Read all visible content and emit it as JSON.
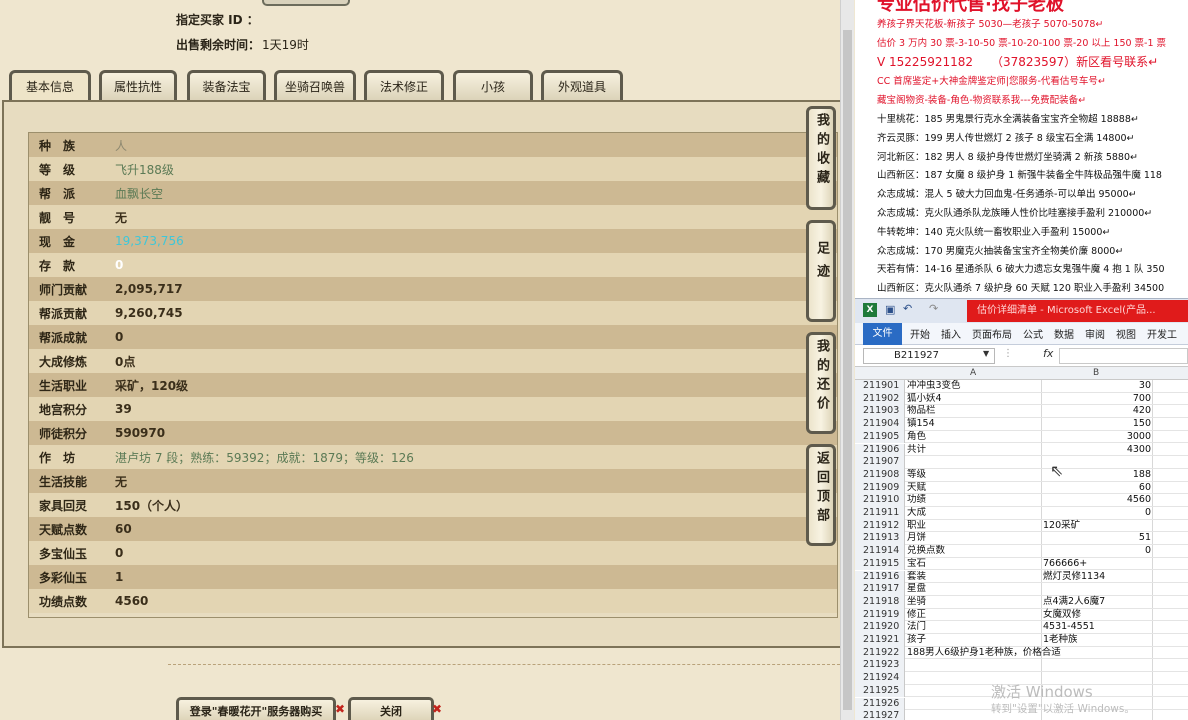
{
  "header": {
    "buyer_label": "指定买家 ID ：",
    "time_label": "出售剩余时间：",
    "time_value": "1天19时"
  },
  "tabs": [
    "基本信息",
    "属性抗性",
    "装备法宝",
    "坐骑召唤兽",
    "法术修正",
    "小孩",
    "外观道具"
  ],
  "info_rows": [
    {
      "k": "种　族",
      "v": "人"
    },
    {
      "k": "等　级",
      "v": "飞升188级"
    },
    {
      "k": "帮　派",
      "v": "血飘长空"
    },
    {
      "k": "靓　号",
      "v": "无"
    },
    {
      "k": "现　金",
      "v": "19,373,756"
    },
    {
      "k": "存　款",
      "v": "0"
    },
    {
      "k": "师门贡献",
      "v": "2,095,717"
    },
    {
      "k": "帮派贡献",
      "v": "9,260,745"
    },
    {
      "k": "帮派成就",
      "v": "0"
    },
    {
      "k": "大成修炼",
      "v": "0点"
    },
    {
      "k": "生活职业",
      "v": "采矿，120级"
    },
    {
      "k": "地宫积分",
      "v": "39"
    },
    {
      "k": "师徒积分",
      "v": "590970"
    },
    {
      "k": "作　坊",
      "v": "湛卢坊 7 段；熟练：59392；成就：1879；等级：126"
    },
    {
      "k": "生活技能",
      "v": "无"
    },
    {
      "k": "家具回灵",
      "v": "150（个人）"
    },
    {
      "k": "天赋点数",
      "v": "60"
    },
    {
      "k": "多宝仙玉",
      "v": "0"
    },
    {
      "k": "多彩仙玉",
      "v": "1"
    },
    {
      "k": "功绩点数",
      "v": "4560"
    }
  ],
  "side_buttons": [
    "我的收藏",
    "足迹",
    "我的还价",
    "返回顶部"
  ],
  "bottom_buttons": {
    "login": "登录\"春暖花开\"服务器购买",
    "close": "关闭"
  },
  "doc": {
    "banner": "专业估价代售·找子老板",
    "lines": [
      "养孩子界天花板-新孩子 5030—老孩子 5070-5078↵",
      "估价 3 万内 30 票-3-10-50 票-10-20-100 票-20 以上 150 票-1 票",
      "V 15225921182　　（37823597）新区看号联系↵",
      "CC 首席鉴定+大神金牌鉴定师|您服务-代看估号车号↵",
      "藏宝阁物资-装备-角色-物资联系我---免费配装备↵",
      "十里桃花：185 男鬼景行克水全满装备宝宝齐全物超 18888↵",
      "齐云灵豚：199 男人传世燃灯 2 孩子 8 级宝石全满 14800↵",
      "河北新区：182 男人 8 级护身传世燃灯坐骑满 2 新孩 5880↵",
      "山西新区：187 女魔 8 级护身 1 新强牛装备全牛阵极品强牛魔 118",
      "众志成城：混人 5 破大力回血鬼-任务通杀-可以单出 95000↵",
      "众志成城：克火队通杀队龙族睡人性价比哇塞接手盈利 210000↵",
      "牛转乾坤：140 克火队统一畜牧职业入手盈利 15000↵",
      "众志成城：170 男魔克火抽装备宝宝齐全物美价廉 8000↵",
      "天若有情：14-16 星通杀队 6 破大力遗忘女鬼强牛魔 4 抱 1 队 350",
      "山西新区：克火队通杀 7 级护身 60 天赋 120 职业入手盈利 34500"
    ]
  },
  "excel": {
    "title": "估价详细清单 - Microsoft Excel(产品...",
    "ribbon": [
      "文件",
      "开始",
      "插入",
      "页面布局",
      "公式",
      "数据",
      "审阅",
      "视图",
      "开发工"
    ],
    "name_box": "B211927",
    "fx": "fx",
    "cols": [
      "A",
      "B"
    ],
    "rows": [
      {
        "n": "211901",
        "a": "冲冲虫3变色",
        "b": "30",
        "num": true
      },
      {
        "n": "211902",
        "a": "狐小妖4",
        "b": "700",
        "num": true
      },
      {
        "n": "211903",
        "a": "物品栏",
        "b": "420",
        "num": true
      },
      {
        "n": "211904",
        "a": "镇154",
        "b": "150",
        "num": true
      },
      {
        "n": "211905",
        "a": "角色",
        "b": "3000",
        "num": true
      },
      {
        "n": "211906",
        "a": "共计",
        "b": "4300",
        "num": true
      },
      {
        "n": "211907",
        "a": "",
        "b": "",
        "num": true
      },
      {
        "n": "211908",
        "a": "等级",
        "b": "188",
        "num": true
      },
      {
        "n": "211909",
        "a": "天赋",
        "b": "60",
        "num": true
      },
      {
        "n": "211910",
        "a": "功绩",
        "b": "4560",
        "num": true
      },
      {
        "n": "211911",
        "a": "大成",
        "b": "0",
        "num": true
      },
      {
        "n": "211912",
        "a": "职业",
        "b": "120采矿",
        "num": false
      },
      {
        "n": "211913",
        "a": "月饼",
        "b": "51",
        "num": true
      },
      {
        "n": "211914",
        "a": "兑换点数",
        "b": "0",
        "num": true
      },
      {
        "n": "211915",
        "a": "宝石",
        "b": "766666+",
        "num": false
      },
      {
        "n": "211916",
        "a": "套装",
        "b": "燃灯灵修1134",
        "num": false
      },
      {
        "n": "211917",
        "a": "星盘",
        "b": "",
        "num": false
      },
      {
        "n": "211918",
        "a": "坐骑",
        "b": "点4满2人6魔7",
        "num": false
      },
      {
        "n": "211919",
        "a": "修正",
        "b": "女魔双修",
        "num": false
      },
      {
        "n": "211920",
        "a": "法门",
        "b": "4531-4551",
        "num": false
      },
      {
        "n": "211921",
        "a": "孩子",
        "b": "1老种族",
        "num": false
      },
      {
        "n": "211922",
        "a": "188男人6级护身1老种族，价格合适",
        "b": "",
        "num": false
      },
      {
        "n": "211923",
        "a": "",
        "b": "",
        "num": false
      },
      {
        "n": "211924",
        "a": "",
        "b": "",
        "num": false
      },
      {
        "n": "211925",
        "a": "",
        "b": "",
        "num": false
      },
      {
        "n": "211926",
        "a": "",
        "b": "",
        "num": false
      },
      {
        "n": "211927",
        "a": "",
        "b": "",
        "num": false
      }
    ],
    "watermark_title": "激活 Windows",
    "watermark_sub": "转到\"设置\"以激活 Windows。"
  }
}
